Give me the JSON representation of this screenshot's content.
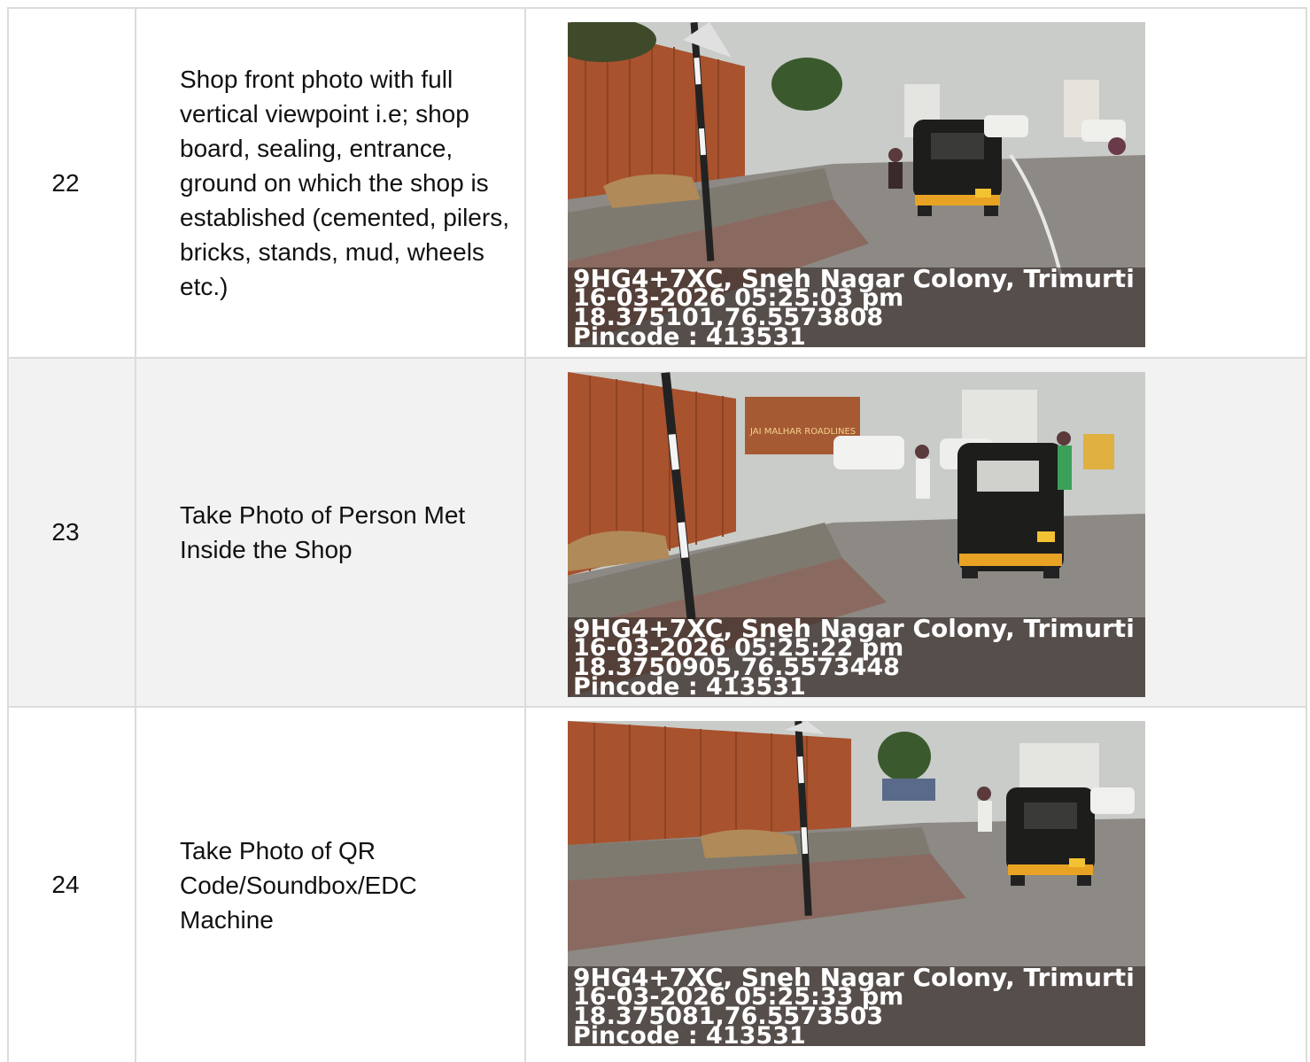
{
  "rows": [
    {
      "number": "22",
      "description": "Shop front photo with full vertical viewpoint i.e; shop board, sealing, entrance, ground on which the shop is established (cemented, pilers, bricks, stands, mud, wheels etc.)",
      "stamp": {
        "address": "9HG4+7XC, Sneh Nagar Colony, Trimurti",
        "datetime": "16-03-2026 05:25:03 pm",
        "coords": "18.375101,76.5573808",
        "pincode": "Pincode : 413531"
      }
    },
    {
      "number": "23",
      "description": "Take Photo of Person Met Inside the Shop",
      "truck_text": "JAI MALHAR ROADLINES",
      "stamp": {
        "address": "9HG4+7XC, Sneh Nagar Colony, Trimurti",
        "datetime": "16-03-2026 05:25:22 pm",
        "coords": "18.3750905,76.5573448",
        "pincode": "Pincode : 413531"
      }
    },
    {
      "number": "24",
      "description": "Take Photo of QR Code/Soundbox/EDC Machine",
      "stamp": {
        "address": "9HG4+7XC, Sneh Nagar Colony, Trimurti",
        "datetime": "16-03-2026 05:25:33 pm",
        "coords": "18.375081,76.5573503",
        "pincode": "Pincode : 413531"
      }
    }
  ],
  "colors": {
    "sky": "#c9ccc8",
    "fence": "#a8522e",
    "road": "#8d8985",
    "curb": "#7e7a70",
    "rickshaw": "#1d1d1b",
    "rickshaw_trim": "#e8a224"
  }
}
